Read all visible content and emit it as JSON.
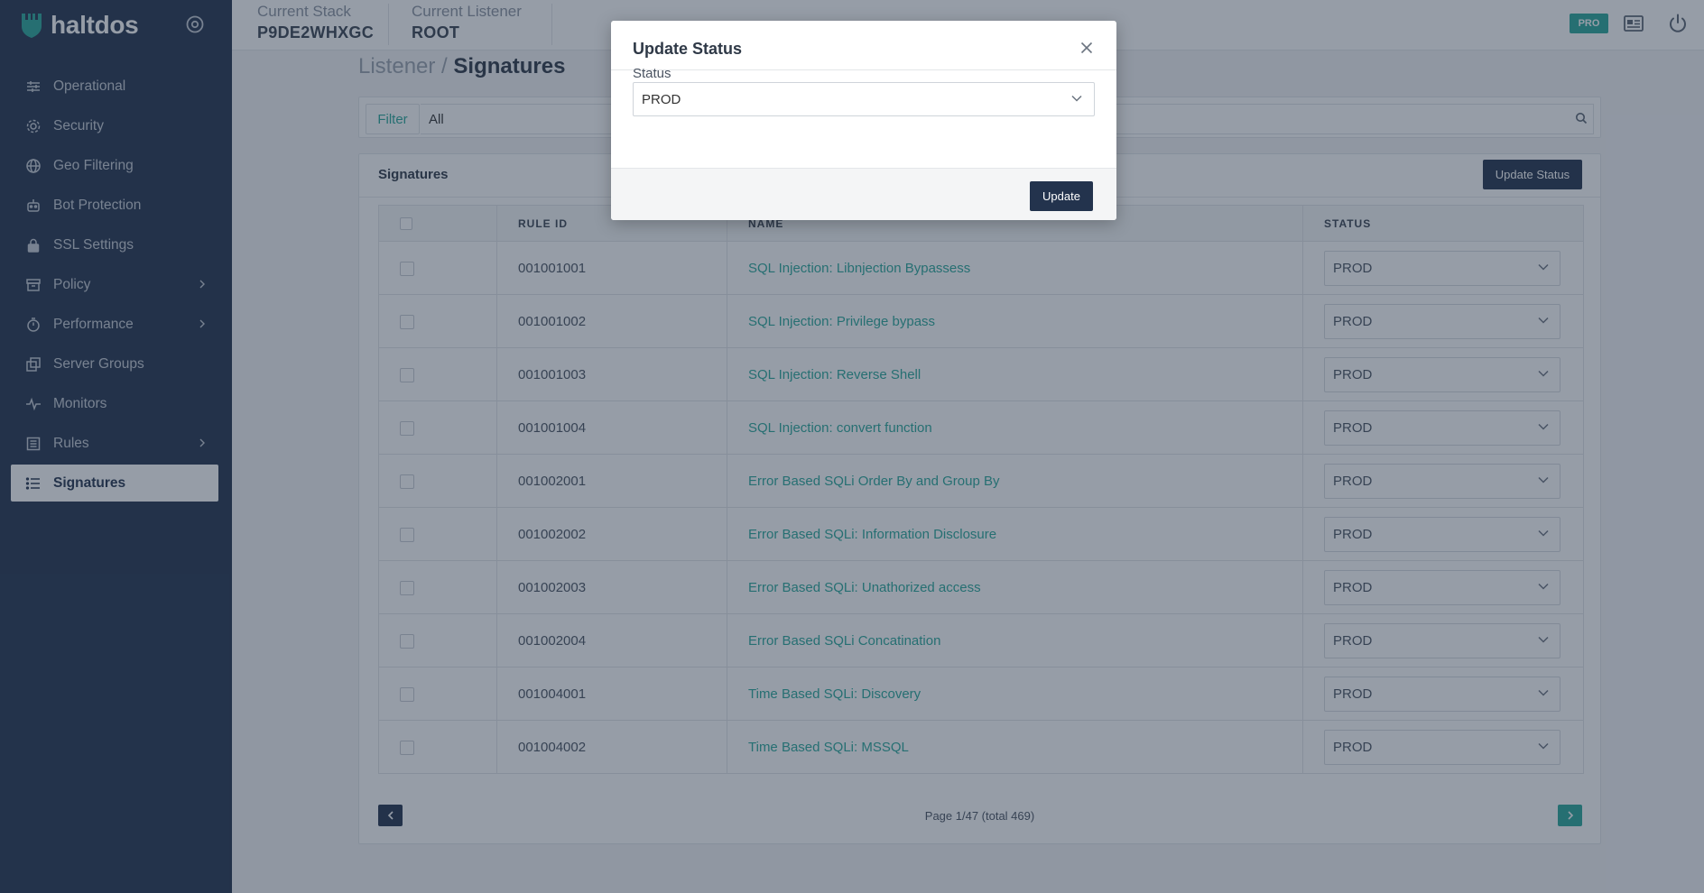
{
  "app": {
    "brand": "haltdos"
  },
  "sidebar": {
    "items": [
      {
        "label": "Operational",
        "icon": "sliders-icon",
        "has_submenu": false
      },
      {
        "label": "Security",
        "icon": "gear-icon",
        "has_submenu": false
      },
      {
        "label": "Geo Filtering",
        "icon": "globe-icon",
        "has_submenu": false
      },
      {
        "label": "Bot Protection",
        "icon": "robot-icon",
        "has_submenu": false
      },
      {
        "label": "SSL Settings",
        "icon": "lock-icon",
        "has_submenu": false
      },
      {
        "label": "Policy",
        "icon": "archive-icon",
        "has_submenu": true
      },
      {
        "label": "Performance",
        "icon": "stopwatch-icon",
        "has_submenu": true
      },
      {
        "label": "Server Groups",
        "icon": "copy-icon",
        "has_submenu": false
      },
      {
        "label": "Monitors",
        "icon": "pulse-icon",
        "has_submenu": false
      },
      {
        "label": "Rules",
        "icon": "list-box-icon",
        "has_submenu": true
      },
      {
        "label": "Signatures",
        "icon": "list-icon",
        "has_submenu": false,
        "active": true
      }
    ]
  },
  "header": {
    "stack_label": "Current Stack",
    "stack_value": "P9DE2WHXGC",
    "listener_label": "Current Listener",
    "listener_value": "ROOT",
    "badge": "PRO"
  },
  "breadcrumb": {
    "parent": "Listener",
    "separator": " / ",
    "current": "Signatures"
  },
  "filter": {
    "label": "Filter",
    "value": "All"
  },
  "signatures": {
    "title": "Signatures",
    "update_button": "Update Status",
    "columns": [
      "",
      "RULE ID",
      "NAME",
      "STATUS"
    ],
    "rows": [
      {
        "rule_id": "001001001",
        "name": "SQL Injection: Libnjection Bypassess",
        "status": "PROD"
      },
      {
        "rule_id": "001001002",
        "name": "SQL Injection: Privilege bypass",
        "status": "PROD"
      },
      {
        "rule_id": "001001003",
        "name": "SQL Injection: Reverse Shell",
        "status": "PROD"
      },
      {
        "rule_id": "001001004",
        "name": "SQL Injection: convert function",
        "status": "PROD"
      },
      {
        "rule_id": "001002001",
        "name": "Error Based SQLi Order By and Group By",
        "status": "PROD"
      },
      {
        "rule_id": "001002002",
        "name": "Error Based SQLi: Information Disclosure",
        "status": "PROD"
      },
      {
        "rule_id": "001002003",
        "name": "Error Based SQLi: Unathorized access",
        "status": "PROD"
      },
      {
        "rule_id": "001002004",
        "name": "Error Based SQLi Concatination",
        "status": "PROD"
      },
      {
        "rule_id": "001004001",
        "name": "Time Based SQLi: Discovery",
        "status": "PROD"
      },
      {
        "rule_id": "001004002",
        "name": "Time Based SQLi: MSSQL",
        "status": "PROD"
      }
    ],
    "pagination": "Page 1/47 (total 469)"
  },
  "modal": {
    "title": "Update Status",
    "field_label": "Status",
    "field_value": "PROD",
    "submit": "Update"
  },
  "colors": {
    "sidebar": "#23334d",
    "accent": "#2aa89a",
    "dark_button": "#23334d"
  }
}
